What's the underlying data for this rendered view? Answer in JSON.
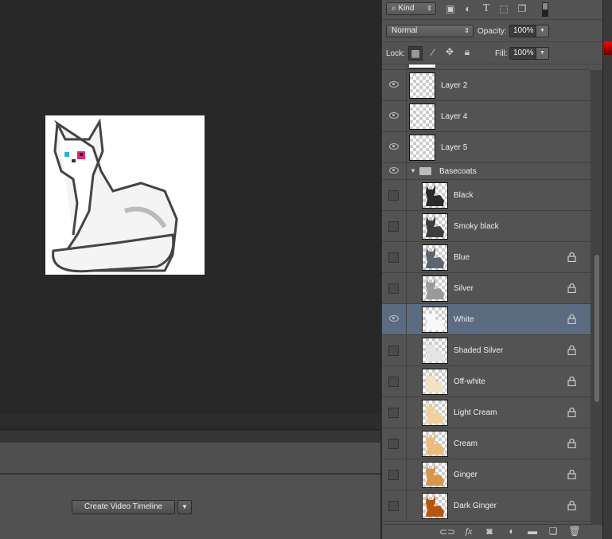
{
  "layers_panel": {
    "filter": {
      "kind_label": "Kind"
    },
    "blend_mode": "Normal",
    "opacity_label": "Opacity:",
    "opacity_value": "100%",
    "lock_label": "Lock:",
    "fill_label": "Fill:",
    "fill_value": "100%",
    "layers": [
      {
        "name": "Layer 2",
        "visible": true
      },
      {
        "name": "Layer 4",
        "visible": true
      },
      {
        "name": "Layer 5",
        "visible": true
      }
    ],
    "group": {
      "name": "Basecoats",
      "visible": true,
      "expanded": true
    },
    "group_layers": [
      {
        "name": "Black",
        "visible": false,
        "locked": false,
        "color": "#2a2a2a"
      },
      {
        "name": "Smoky black",
        "visible": false,
        "locked": false,
        "color": "#3d3d3d"
      },
      {
        "name": "Blue",
        "visible": false,
        "locked": true,
        "color": "#5d6470"
      },
      {
        "name": "Silver",
        "visible": false,
        "locked": true,
        "color": "#9a9a9a"
      },
      {
        "name": "White",
        "visible": true,
        "locked": true,
        "selected": true,
        "color": "#f8f8f8"
      },
      {
        "name": "Shaded Silver",
        "visible": false,
        "locked": true,
        "color": "#e4e4e4"
      },
      {
        "name": "Off-white",
        "visible": false,
        "locked": true,
        "color": "#efe3c8"
      },
      {
        "name": "Light Cream",
        "visible": false,
        "locked": true,
        "color": "#f1d29c"
      },
      {
        "name": "Cream",
        "visible": false,
        "locked": true,
        "color": "#ebbc7a"
      },
      {
        "name": "Ginger",
        "visible": false,
        "locked": true,
        "color": "#d8964a"
      },
      {
        "name": "Dark Ginger",
        "visible": false,
        "locked": true,
        "color": "#b5560f"
      }
    ]
  },
  "timeline": {
    "create_button": "Create Video Timeline"
  }
}
